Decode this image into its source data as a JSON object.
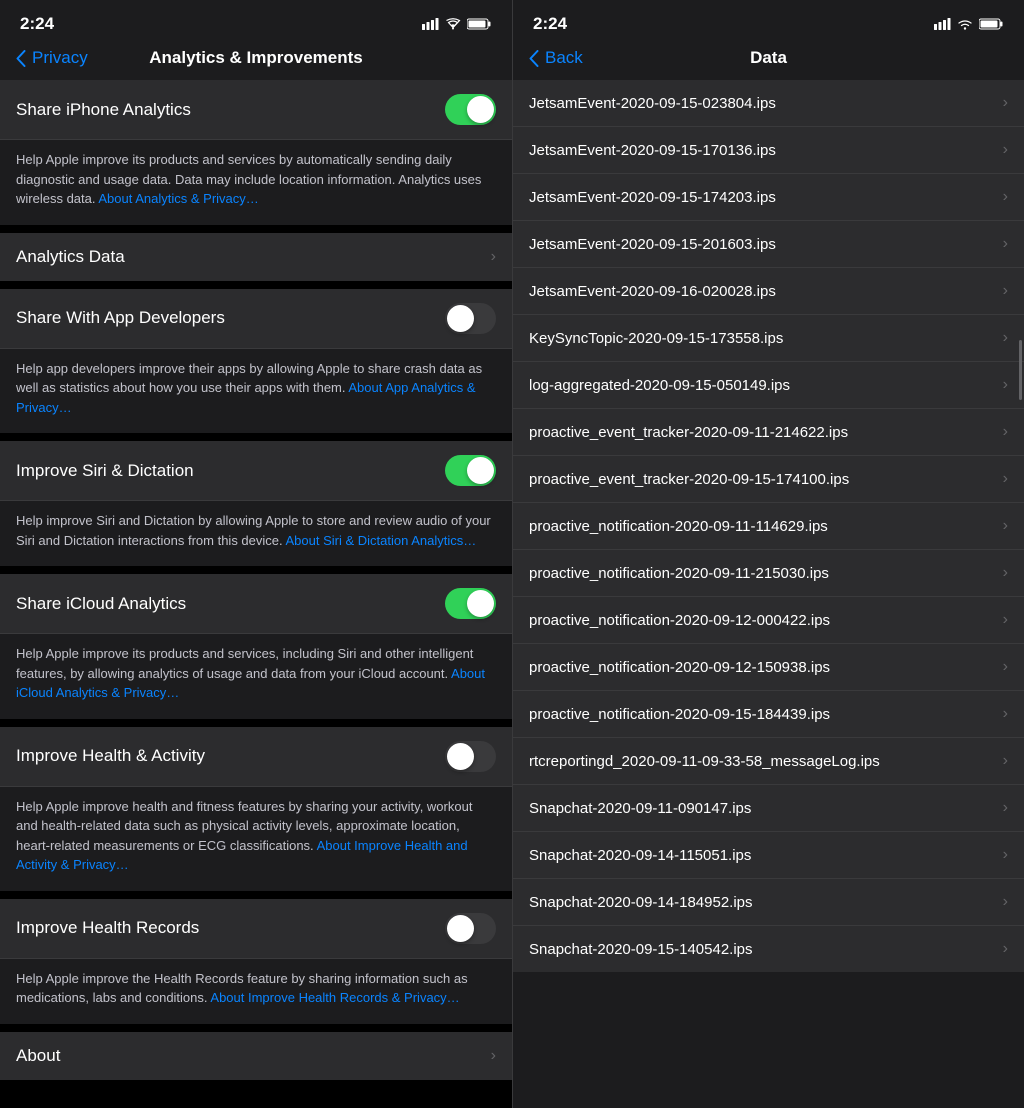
{
  "left": {
    "status_time": "2:24",
    "nav_back_label": "Privacy",
    "nav_title": "Analytics & Improvements",
    "rows": [
      {
        "id": "share-iphone-analytics",
        "label": "Share iPhone Analytics",
        "toggle": true,
        "enabled": true,
        "description": "Help Apple improve its products and services by automatically sending daily diagnostic and usage data. Data may include location information. Analytics uses wireless data.",
        "link_text": "About Analytics & Privacy…",
        "link_href": "#"
      },
      {
        "id": "analytics-data",
        "label": "Analytics Data",
        "toggle": false,
        "enabled": false,
        "description": null
      },
      {
        "id": "share-with-app-developers",
        "label": "Share With App Developers",
        "toggle": true,
        "enabled": false,
        "description": "Help app developers improve their apps by allowing Apple to share crash data as well as statistics about how you use their apps with them.",
        "link_text": "About App Analytics & Privacy…",
        "link_href": "#"
      },
      {
        "id": "improve-siri-dictation",
        "label": "Improve Siri & Dictation",
        "toggle": true,
        "enabled": true,
        "description": "Help improve Siri and Dictation by allowing Apple to store and review audio of your Siri and Dictation interactions from this device.",
        "link_text": "About Siri & Dictation Analytics…",
        "link_href": "#"
      },
      {
        "id": "share-icloud-analytics",
        "label": "Share iCloud Analytics",
        "toggle": true,
        "enabled": true,
        "description": "Help Apple improve its products and services, including Siri and other intelligent features, by allowing analytics of usage and data from your iCloud account.",
        "link_text": "About iCloud Analytics & Privacy…",
        "link_href": "#"
      },
      {
        "id": "improve-health-activity",
        "label": "Improve Health & Activity",
        "toggle": true,
        "enabled": false,
        "description": "Help Apple improve health and fitness features by sharing your activity, workout and health-related data such as physical activity levels, approximate location, heart-related measurements or ECG classifications.",
        "link_text": "About Improve Health and Activity & Privacy…",
        "link_href": "#"
      },
      {
        "id": "improve-health-records",
        "label": "Improve Health Records",
        "toggle": true,
        "enabled": false,
        "description": "Help Apple improve the Health Records feature by sharing information such as medications, labs and conditions.",
        "link_text": "About Improve Health Records & Privacy…",
        "link_href": "#"
      }
    ],
    "about_label": "About"
  },
  "right": {
    "status_time": "2:24",
    "nav_back_label": "Back",
    "nav_title": "Data",
    "items": [
      "JetsamEvent-2020-09-15-023804.ips",
      "JetsamEvent-2020-09-15-170136.ips",
      "JetsamEvent-2020-09-15-174203.ips",
      "JetsamEvent-2020-09-15-201603.ips",
      "JetsamEvent-2020-09-16-020028.ips",
      "KeySyncTopic-2020-09-15-173558.ips",
      "log-aggregated-2020-09-15-050149.ips",
      "proactive_event_tracker-2020-09-11-214622.ips",
      "proactive_event_tracker-2020-09-15-174100.ips",
      "proactive_notification-2020-09-11-114629.ips",
      "proactive_notification-2020-09-11-215030.ips",
      "proactive_notification-2020-09-12-000422.ips",
      "proactive_notification-2020-09-12-150938.ips",
      "proactive_notification-2020-09-15-184439.ips",
      "rtcreportingd_2020-09-11-09-33-58_messageLog.ips",
      "Snapchat-2020-09-11-090147.ips",
      "Snapchat-2020-09-14-115051.ips",
      "Snapchat-2020-09-14-184952.ips",
      "Snapchat-2020-09-15-140542.ips"
    ]
  }
}
